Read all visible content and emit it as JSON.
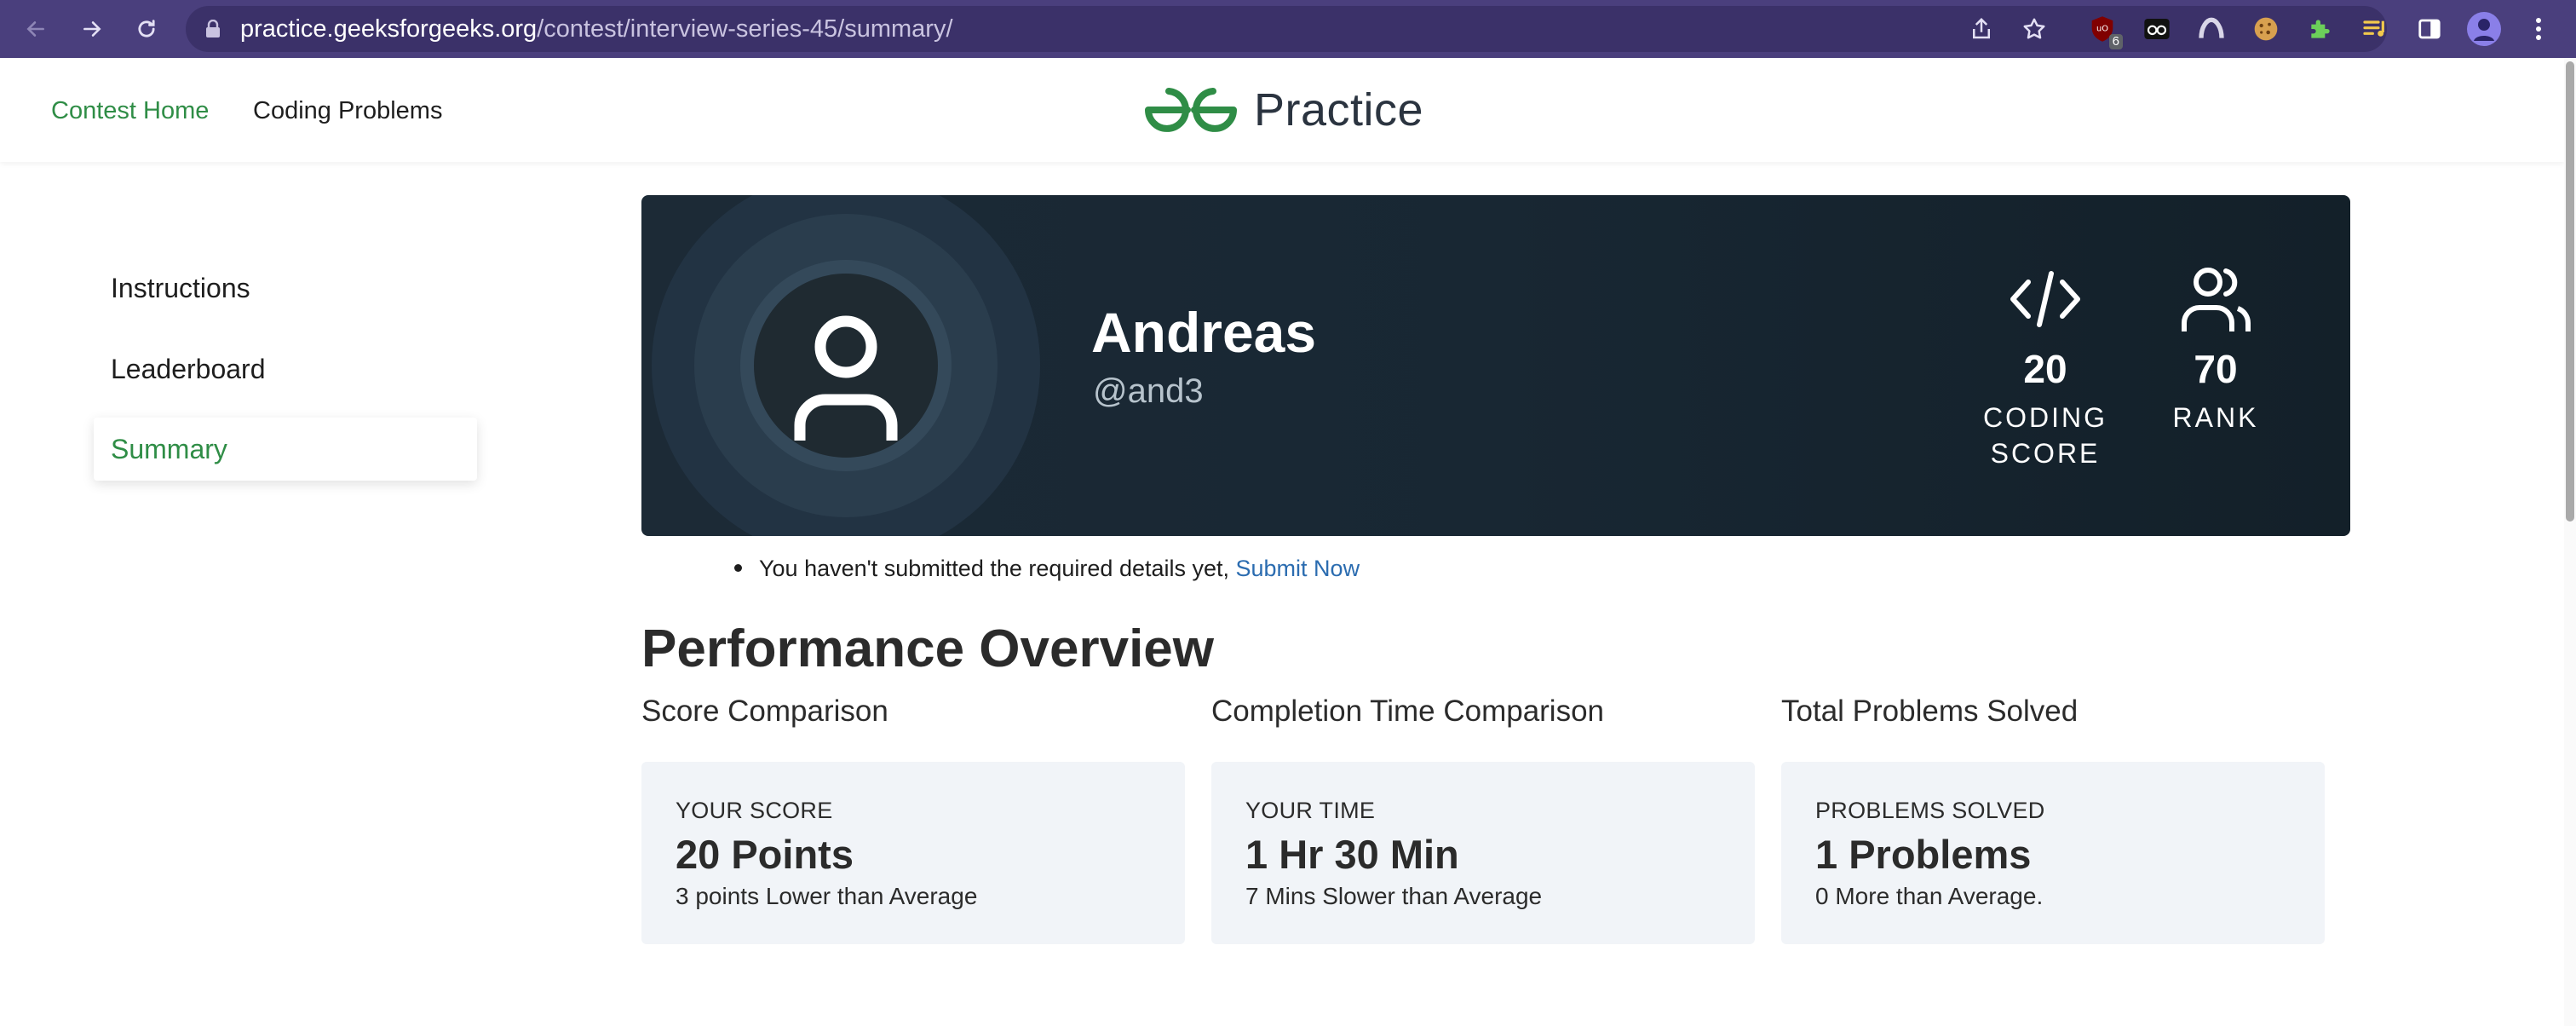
{
  "browser": {
    "url_host": "practice.geeksforgeeks.org",
    "url_path": "/contest/interview-series-45/summary/",
    "extension_badge": "6"
  },
  "header": {
    "contest_home": "Contest Home",
    "coding_problems": "Coding Problems",
    "logo_text": "Practice"
  },
  "sidebar": {
    "items": [
      {
        "label": "Instructions"
      },
      {
        "label": "Leaderboard"
      },
      {
        "label": "Summary"
      }
    ]
  },
  "profile": {
    "name": "Andreas",
    "handle": "@and3",
    "coding_score_value": "20",
    "coding_score_label_1": "CODING",
    "coding_score_label_2": "SCORE",
    "rank_value": "70",
    "rank_label": "RANK"
  },
  "notice": {
    "text": "You haven't submitted the required details yet, ",
    "link": "Submit Now"
  },
  "performance": {
    "title": "Performance Overview",
    "columns": [
      {
        "title": "Score Comparison",
        "caption": "YOUR SCORE",
        "value": "20 Points",
        "sub": "3 points Lower than Average"
      },
      {
        "title": "Completion Time Comparison",
        "caption": "YOUR TIME",
        "value": "1 Hr 30 Min",
        "sub": "7 Mins Slower than Average"
      },
      {
        "title": "Total Problems Solved",
        "caption": "PROBLEMS SOLVED",
        "value": "1 Problems",
        "sub": "0 More than Average."
      }
    ]
  },
  "colors": {
    "chrome": "#4a3f7d",
    "brand_green": "#2f8d46",
    "banner": "#182733",
    "link_blue": "#2b6cb0",
    "card_bg": "#f1f4f8"
  }
}
